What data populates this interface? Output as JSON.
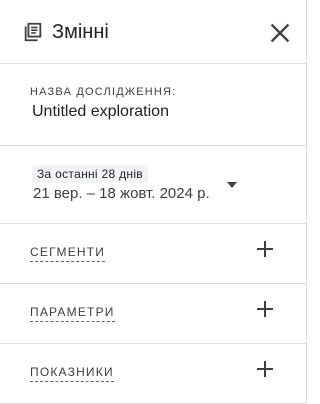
{
  "header": {
    "title": "Змінні",
    "icon": "library-books-icon",
    "close_icon": "close-icon"
  },
  "exploration": {
    "label": "НАЗВА ДОСЛІДЖЕННЯ:",
    "name": "Untitled exploration"
  },
  "date_range": {
    "preset": "За останні 28 днів",
    "range": "21 вер. – 18 жовт. 2024 р.",
    "dropdown_icon": "caret-down-icon"
  },
  "sections": [
    {
      "label": "СЕГМЕНТИ",
      "add_icon": "plus-icon"
    },
    {
      "label": "ПАРАМЕТРИ",
      "add_icon": "plus-icon"
    },
    {
      "label": "ПОКАЗНИКИ",
      "add_icon": "plus-icon"
    }
  ],
  "colors": {
    "text": "#202124",
    "secondary_text": "#3c4043",
    "divider": "#dadce0",
    "chip_bg": "#f1f3f4"
  }
}
